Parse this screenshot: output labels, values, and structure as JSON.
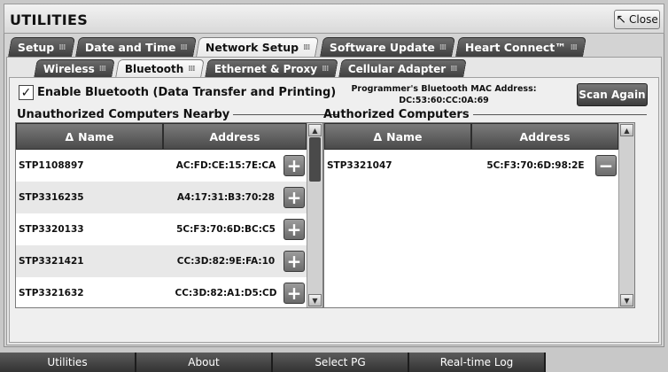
{
  "window": {
    "title": "UTILITIES",
    "close_label": "Close"
  },
  "primary_tabs": [
    {
      "label": "Setup",
      "active": false
    },
    {
      "label": "Date and Time",
      "active": false
    },
    {
      "label": "Network Setup",
      "active": true
    },
    {
      "label": "Software Update",
      "active": false
    },
    {
      "label": "Heart Connect™",
      "active": false
    }
  ],
  "secondary_tabs": [
    {
      "label": "Wireless",
      "active": false
    },
    {
      "label": "Bluetooth",
      "active": true
    },
    {
      "label": "Ethernet & Proxy",
      "active": false
    },
    {
      "label": "Cellular Adapter",
      "active": false
    }
  ],
  "bluetooth": {
    "enable_label": "Enable Bluetooth (Data Transfer and Printing)",
    "enable_checked": true,
    "mac_label": "Programmer's Bluetooth MAC Address:",
    "mac_value": "DC:53:60:CC:0A:69",
    "scan_label": "Scan Again"
  },
  "unauthorized": {
    "title": "Unauthorized Computers Nearby",
    "col_name": "Name",
    "col_address": "Address",
    "rows": [
      {
        "name": "STP1108897",
        "address": "AC:FD:CE:15:7E:CA"
      },
      {
        "name": "STP3316235",
        "address": "A4:17:31:B3:70:28"
      },
      {
        "name": "STP3320133",
        "address": "5C:F3:70:6D:BC:C5"
      },
      {
        "name": "STP3321421",
        "address": "CC:3D:82:9E:FA:10"
      },
      {
        "name": "STP3321632",
        "address": "CC:3D:82:A1:D5:CD"
      }
    ]
  },
  "authorized": {
    "title": "Authorized Computers",
    "col_name": "Name",
    "col_address": "Address",
    "rows": [
      {
        "name": "STP3321047",
        "address": "5C:F3:70:6D:98:2E"
      }
    ]
  },
  "bottom_nav": [
    "Utilities",
    "About",
    "Select PG",
    "Real-time Log"
  ]
}
